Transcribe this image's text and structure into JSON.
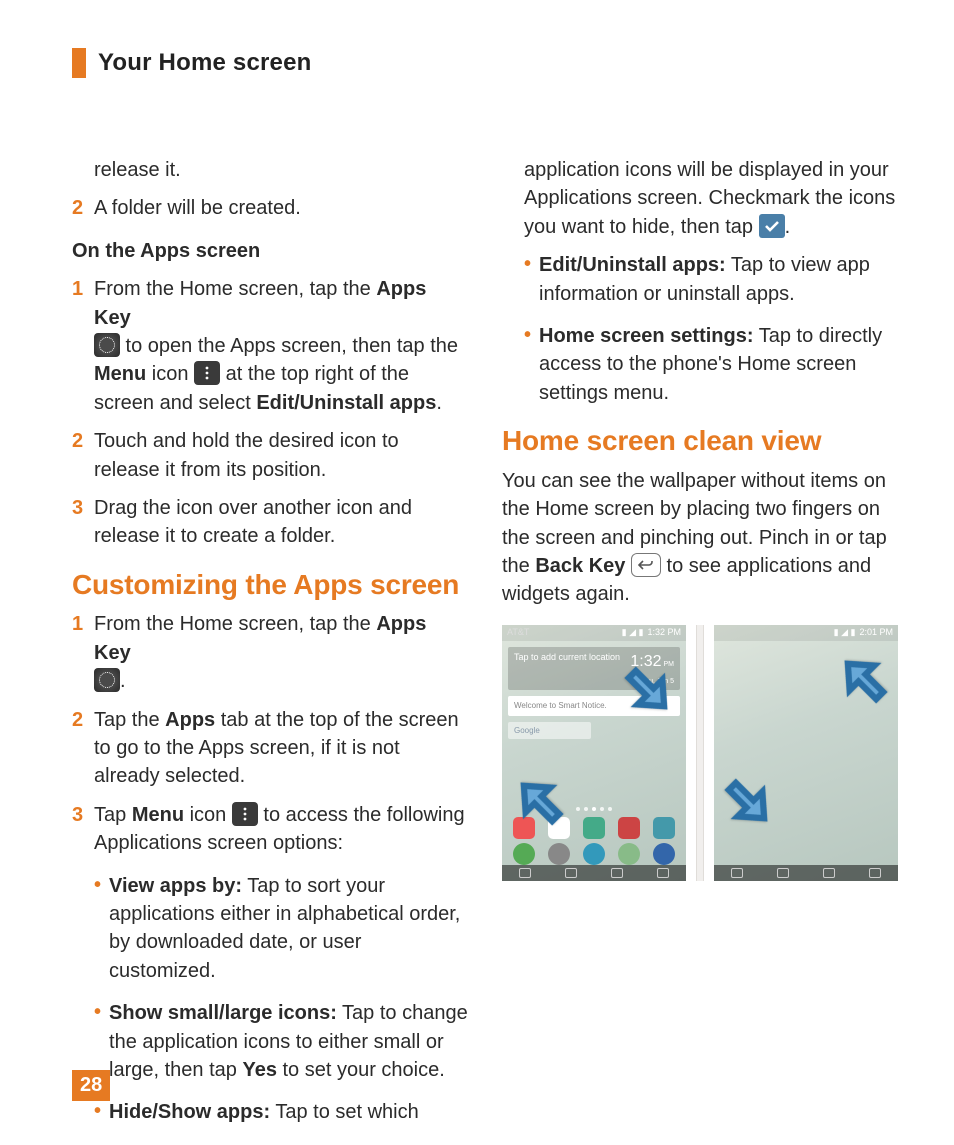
{
  "header": {
    "title": "Your Home screen"
  },
  "pageNumber": "28",
  "colors": {
    "accent": "#e67a22",
    "checkIcon": "#4a7fa8"
  },
  "icons": {
    "apps": "apps-key-grid-icon",
    "menu": "menu-dots-icon",
    "check": "checkmark-icon",
    "back": "back-key-icon"
  },
  "left": {
    "continuationLine": "release it.",
    "step2": "A folder will be created.",
    "subheading": "On the Apps screen",
    "s1_a": "From the Home screen, tap the ",
    "s1_b": "Apps Key",
    "s1_c": " to open the Apps screen, then tap the ",
    "s1_d": "Menu",
    "s1_e": " icon ",
    "s1_f": " at the top right of the screen and select ",
    "s1_g": "Edit/Uninstall apps",
    "s1_h": ".",
    "s2": "Touch and hold the desired icon to release it from its position.",
    "s3": "Drag the icon over another icon and release it to create a folder.",
    "h2a": "Customizing the Apps screen",
    "c1_a": "From the Home screen, tap the ",
    "c1_b": "Apps Key",
    "c1_c": ".",
    "c2_a": "Tap the ",
    "c2_b": "Apps",
    "c2_c": " tab at the top of the screen to go to the Apps screen, if it is not already selected.",
    "c3_a": "Tap ",
    "c3_b": "Menu",
    "c3_c": " icon ",
    "c3_d": " to access the following Applications screen options:",
    "bl1_a": "View apps by:",
    "bl1_b": " Tap to sort your applications either in alphabetical order, by downloaded date, or user customized.",
    "bl2_a": "Show small/large icons:",
    "bl2_b": " Tap to change the application icons to either small or large, then tap ",
    "bl2_c": "Yes",
    "bl2_d": " to set your choice.",
    "bl3_a": "Hide/Show apps:",
    "bl3_b": " Tap to set which"
  },
  "right": {
    "cont": "application icons will be displayed in your Applications screen. Checkmark the icons you want to hide, then tap ",
    "cont_end": ".",
    "bl4_a": "Edit/Uninstall apps:",
    "bl4_b": " Tap to view app information or uninstall apps.",
    "bl5_a": "Home screen settings:",
    "bl5_b": " Tap to directly access to the phone's Home screen settings menu.",
    "h2b": "Home screen clean view",
    "clean_a": "You can see the wallpaper without items on the Home screen by placing two fingers on the screen and pinching out. Pinch in or tap the ",
    "clean_b": "Back Key",
    "clean_c": " to see applications and widgets again.",
    "shot": {
      "carrier": "AT&T",
      "time1": "1:32 PM",
      "time2": "2:01 PM",
      "clock": "1:32",
      "date": "Thu, Jun 5",
      "weather": "Tap to add current location",
      "smart": "Welcome to Smart Notice.",
      "google": "Google"
    }
  }
}
